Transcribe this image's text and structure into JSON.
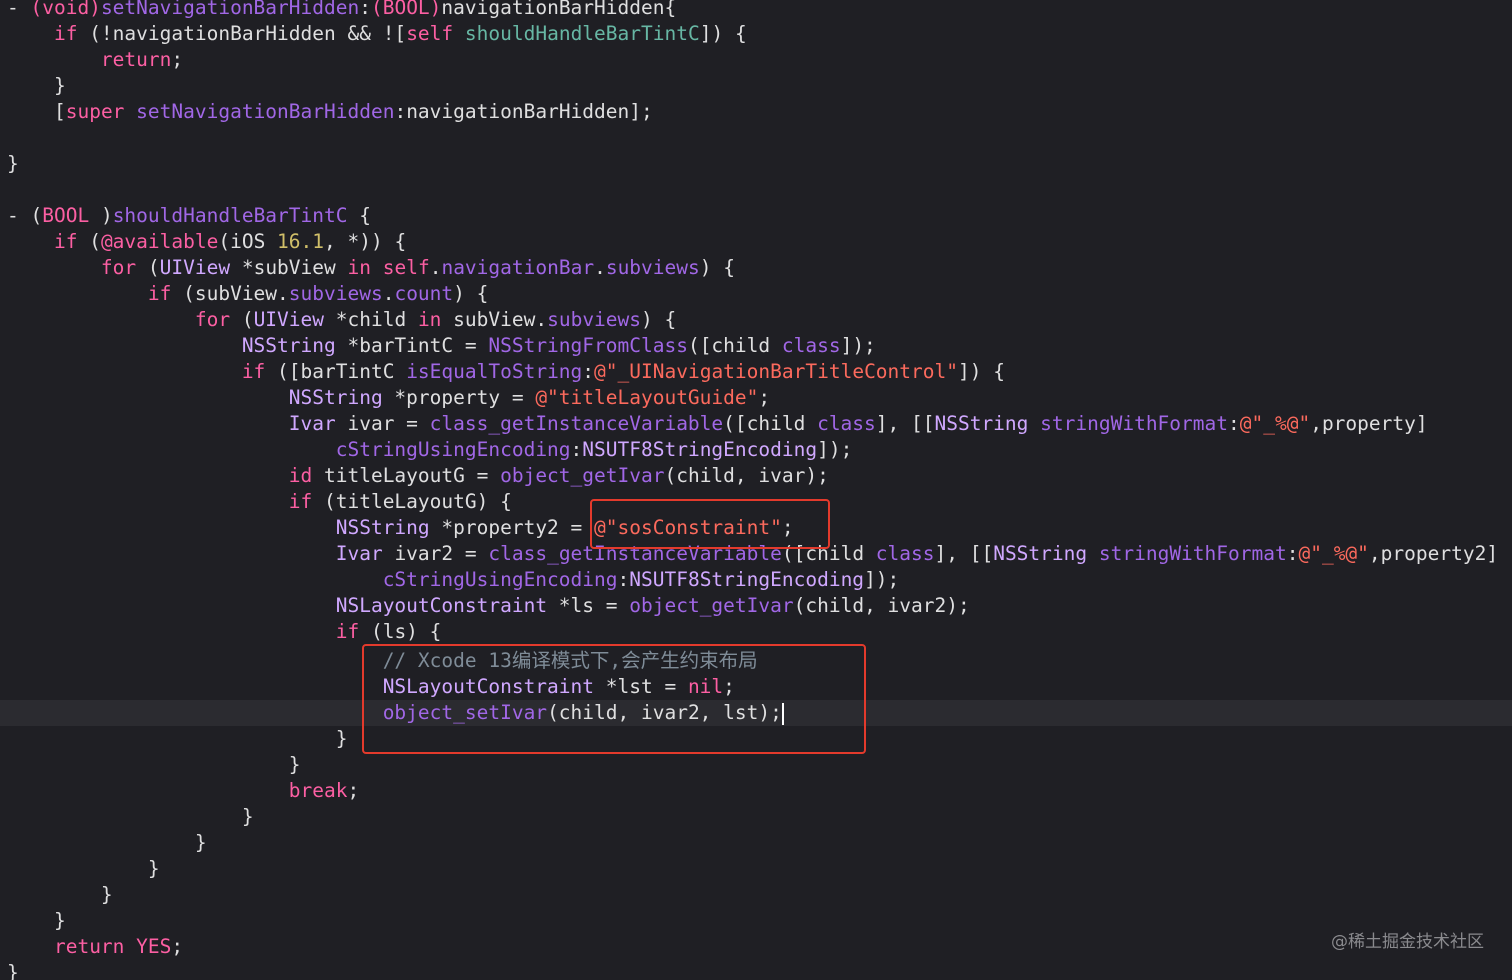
{
  "code": {
    "method1": {
      "decl_dash": "- ",
      "decl_ret": "(void)",
      "decl_name": "setNavigationBarHidden",
      "decl_param_type": "(BOOL)",
      "decl_param": "navigationBarHidden{",
      "if_kw": "if",
      "if_cond1": " (!navigationBarHidden && ![",
      "if_self": "self",
      "if_call": "shouldHandleBarTintC",
      "if_end": "]) {",
      "return_kw": "return",
      "return_end": ";",
      "close_brace": "}",
      "super_open": "[",
      "super_kw": "super",
      "super_call": "setNavigationBarHidden",
      "super_arg": ":navigationBarHidden];",
      "end_brace": "}"
    },
    "method2": {
      "decl_dash": "- ",
      "decl_ret_open": "(",
      "decl_ret": "BOOL",
      "decl_ret_close": " )",
      "decl_name": "shouldHandleBarTintC",
      "decl_open": " {",
      "avail_if": "if",
      "avail_paren": " (",
      "avail_kw": "@available",
      "avail_os": "(iOS ",
      "avail_ver": "16.1",
      "avail_end": ", *)) {",
      "for1_kw": "for",
      "for1_open": " (",
      "for1_type": "UIView",
      "for1_var": " *subView ",
      "for1_in": "in",
      "for1_sp": " ",
      "for1_self": "self",
      "for1_dot": ".",
      "for1_prop1": "navigationBar",
      "for1_dot2": ".",
      "for1_prop2": "subviews",
      "for1_end": ") {",
      "if2_kw": "if",
      "if2_open": " (subView.",
      "if2_prop1": "subviews",
      "if2_dot": ".",
      "if2_prop2": "count",
      "if2_end": ") {",
      "for2_kw": "for",
      "for2_open": " (",
      "for2_type": "UIView",
      "for2_var": " *child ",
      "for2_in": "in",
      "for2_sub": " subView.",
      "for2_prop": "subviews",
      "for2_end": ") {",
      "bar_type": "NSString",
      "bar_var": " *barTintC = ",
      "bar_fn": "NSStringFromClass",
      "bar_open": "([child ",
      "bar_class": "class",
      "bar_end": "]);",
      "if3_kw": "if",
      "if3_open": " ([barTintC ",
      "if3_call": "isEqualToString",
      "if3_colon": ":",
      "if3_str": "@\"_UINavigationBarTitleControl\"",
      "if3_end": "]) {",
      "prop_type": "NSString",
      "prop_var": " *property = ",
      "prop_str": "@\"titleLayoutGuide\"",
      "prop_end": ";",
      "ivar_type": "Ivar",
      "ivar_var": " ivar = ",
      "ivar_fn": "class_getInstanceVariable",
      "ivar_open": "([child ",
      "ivar_class": "class",
      "ivar_mid": "], [[",
      "ivar_ns": "NSString",
      "ivar_sp": " ",
      "ivar_fmt": "stringWithFormat",
      "ivar_colon": ":",
      "ivar_str": "@\"_%@\"",
      "ivar_end": ",property]",
      "cstr_call": "cStringUsingEncoding",
      "cstr_colon": ":",
      "cstr_enc": "NSUTF8StringEncoding",
      "cstr_end": "]);",
      "id_kw": "id",
      "id_var": " titleLayoutG = ",
      "id_fn": "object_getIvar",
      "id_end": "(child, ivar);",
      "if4_kw": "if",
      "if4_end": " (titleLayoutG) {",
      "p2_type": "NSString",
      "p2_var": " *property2 = ",
      "p2_str": "@\"sosConstraint\"",
      "p2_end": ";",
      "iv2_type": "Ivar",
      "iv2_var": " ivar2 = ",
      "iv2_fn": "class_getInstanceVariable",
      "iv2_open": "([child ",
      "iv2_class": "class",
      "iv2_mid": "], [[",
      "iv2_ns": "NSString",
      "iv2_sp": " ",
      "iv2_fmt": "stringWithFormat",
      "iv2_colon": ":",
      "iv2_str": "@\"_%@\"",
      "iv2_end": ",property2]",
      "cs2_call": "cStringUsingEncoding",
      "cs2_colon": ":",
      "cs2_enc": "NSUTF8StringEncoding",
      "cs2_end": "]);",
      "ls_type": "NSLayoutConstraint",
      "ls_var": " *ls = ",
      "ls_fn": "object_getIvar",
      "ls_end": "(child, ivar2);",
      "if5_kw": "if",
      "if5_end": " (ls) {",
      "comment": "// Xcode 13编译模式下,会产生约束布局",
      "lst_type": "NSLayoutConstraint",
      "lst_var": " *lst = ",
      "lst_nil": "nil",
      "lst_end": ";",
      "set_fn": "object_setIvar",
      "set_end": "(child, ivar2, lst);",
      "brace": "}",
      "break_kw": "break",
      "break_end": ";",
      "return_kw": "return",
      "return_sp": " ",
      "return_val": "YES",
      "return_end": ";"
    }
  },
  "watermark": "@稀土掘金技术社区",
  "colors": {
    "background": "#1f1f24",
    "keyword": "#fc5fa3",
    "method": "#a167e6",
    "string": "#fc6a5d",
    "number": "#d0bf69",
    "comment": "#7f8c98",
    "highlight_box": "#e33a2c"
  }
}
